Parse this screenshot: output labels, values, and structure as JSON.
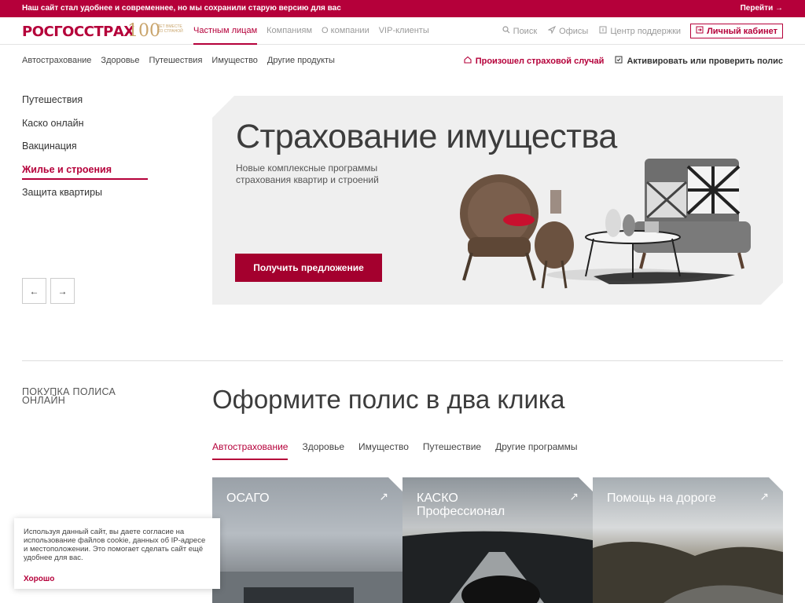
{
  "topbar": {
    "message": "Наш сайт стал удобнее и современнее, но мы сохранили старую версию для вас",
    "go": "Перейти →"
  },
  "header": {
    "logo": "РОСГОССТРАХ",
    "anniversary": {
      "number": "100",
      "text": "ЛЕТ ВМЕСТЕ СО СТРАНОЙ"
    },
    "nav": [
      "Частным лицам",
      "Компаниям",
      "О компании",
      "VIP-клиенты"
    ],
    "util": [
      {
        "icon": "search-icon",
        "label": "Поиск"
      },
      {
        "icon": "location-icon",
        "label": "Офисы"
      },
      {
        "icon": "support-icon",
        "label": "Центр поддержки"
      }
    ],
    "cabinet": "Личный кабинет"
  },
  "subnav": [
    "Автострахование",
    "Здоровье",
    "Путешествия",
    "Имущество",
    "Другие продукты"
  ],
  "subright": [
    "Произошел страховой случай",
    "Активировать или проверить полис"
  ],
  "sidemenu": [
    "Путешествия",
    "Каско онлайн",
    "Вакцинация",
    "Жилье и строения",
    "Защита квартиры"
  ],
  "arrows": {
    "prev": "←",
    "next": "→"
  },
  "hero": {
    "title": "Страхование имущества",
    "subtitle": "Новые комплексные программы страхования квартир и строений",
    "cta": "Получить предложение"
  },
  "section": {
    "label": "ПОКУПКА ПОЛИСА ОНЛАЙН",
    "title": "Оформите полис в два клика",
    "tabs": [
      "Автострахование",
      "Здоровье",
      "Имущество",
      "Путешествие",
      "Другие программы"
    ]
  },
  "cards": [
    {
      "title": "ОСАГО",
      "arrow": "↗"
    },
    {
      "title": "КАСКО Профессионал",
      "arrow": "↗"
    },
    {
      "title": "Помощь на дороге",
      "arrow": "↗"
    }
  ],
  "cookie": {
    "text": "Используя данный сайт, вы даете согласие на использование файлов cookie, данных об IP-адресе и местоположении. Это помогает сделать сайт ещё удобнее для вас.",
    "ok": "Хорошо"
  },
  "colors": {
    "brand": "#b5003a",
    "cta": "#a4002e",
    "anniversary": "#c9a46b"
  }
}
